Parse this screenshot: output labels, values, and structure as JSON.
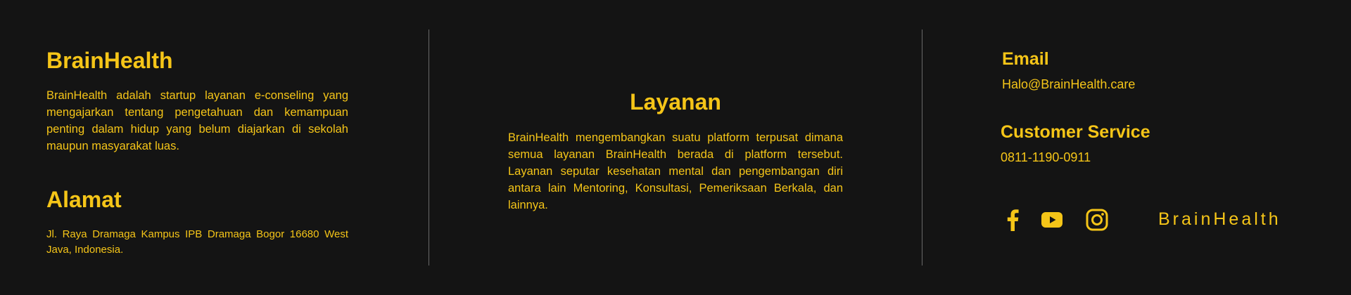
{
  "colors": {
    "background": "#141414",
    "accent": "#f5c518",
    "divider": "#6a6a6a"
  },
  "about": {
    "title": "BrainHealth",
    "description": "BrainHealth adalah startup layanan e-conseling yang mengajarkan tentang pengetahuan dan kemampuan penting dalam hidup yang belum diajarkan di sekolah maupun masyarakat luas."
  },
  "address": {
    "title": "Alamat",
    "text": "Jl. Raya Dramaga Kampus IPB Dramaga Bogor 16680 West Java, Indonesia."
  },
  "services": {
    "title": "Layanan",
    "description": "BrainHealth mengembangkan suatu platform terpusat dimana semua layanan BrainHealth berada di platform tersebut. Layanan seputar kesehatan mental dan pengembangan diri antara lain Mentoring, Konsultasi, Pemeriksaan Berkala, dan lainnya."
  },
  "contact": {
    "email_title": "Email",
    "email_value": "Halo@BrainHealth.care",
    "cs_title": "Customer Service",
    "cs_value": "0811-1190-0911"
  },
  "social": {
    "icons": [
      "facebook-icon",
      "youtube-icon",
      "instagram-icon"
    ],
    "brand_text": "BrainHealth"
  }
}
